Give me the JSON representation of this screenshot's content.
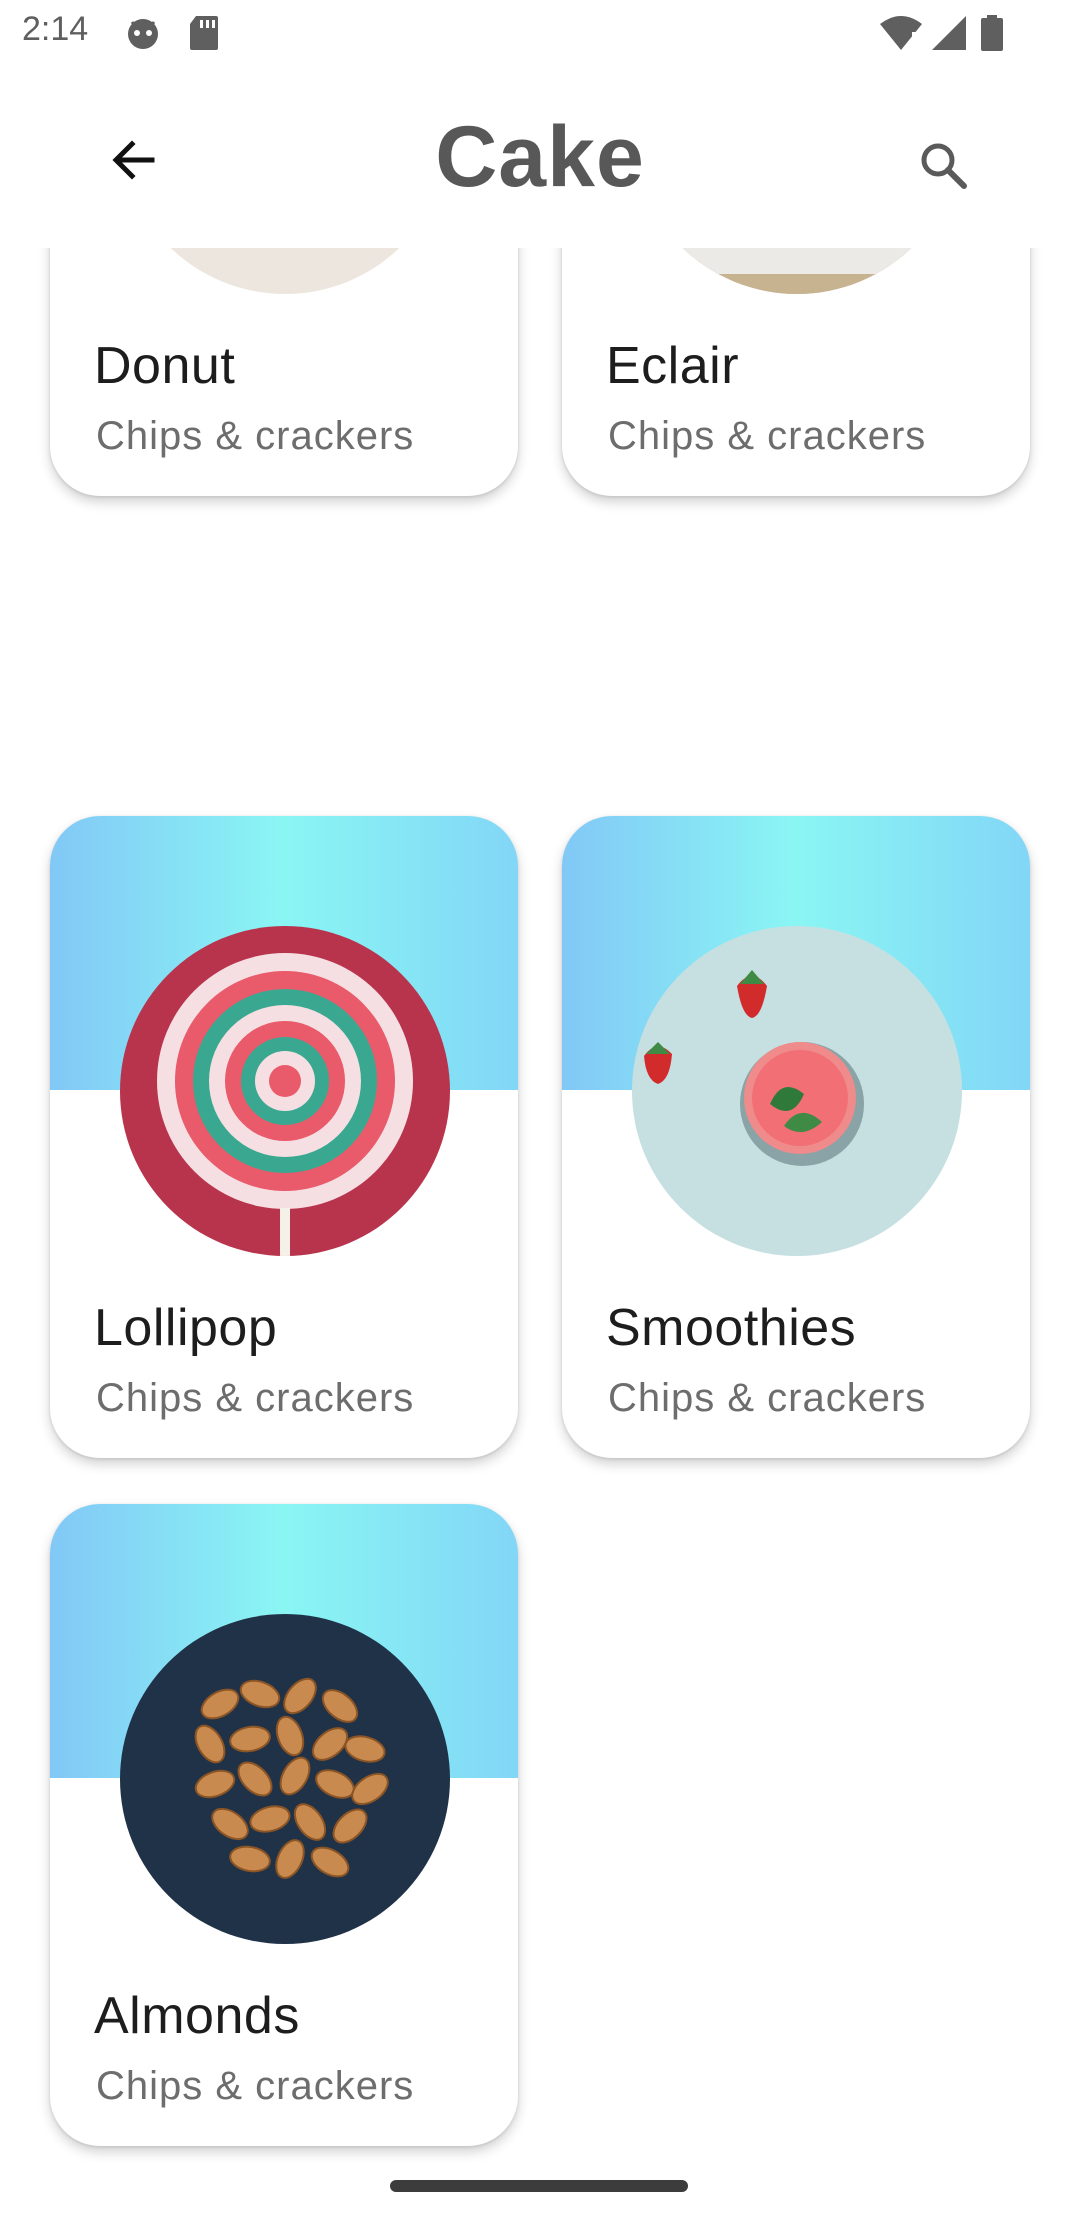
{
  "status_bar": {
    "time": "2:14",
    "icons": [
      "android-debug-icon",
      "sd-card-icon",
      "wifi-icon",
      "signal-icon",
      "battery-icon"
    ]
  },
  "app_bar": {
    "title": "Cake",
    "back_icon": "arrow-back-icon",
    "search_icon": "search-icon"
  },
  "items": [
    {
      "name": "Donut",
      "subtitle": "Chips & crackers"
    },
    {
      "name": "Eclair",
      "subtitle": "Chips & crackers"
    },
    {
      "name": "Lollipop",
      "subtitle": "Chips & crackers"
    },
    {
      "name": "Smoothies",
      "subtitle": "Chips & crackers"
    },
    {
      "name": "Almonds",
      "subtitle": "Chips & crackers"
    }
  ],
  "colors": {
    "card_gradient_left": "#82c8f6",
    "card_gradient_mid": "#8af6f4",
    "title": "#585858"
  }
}
